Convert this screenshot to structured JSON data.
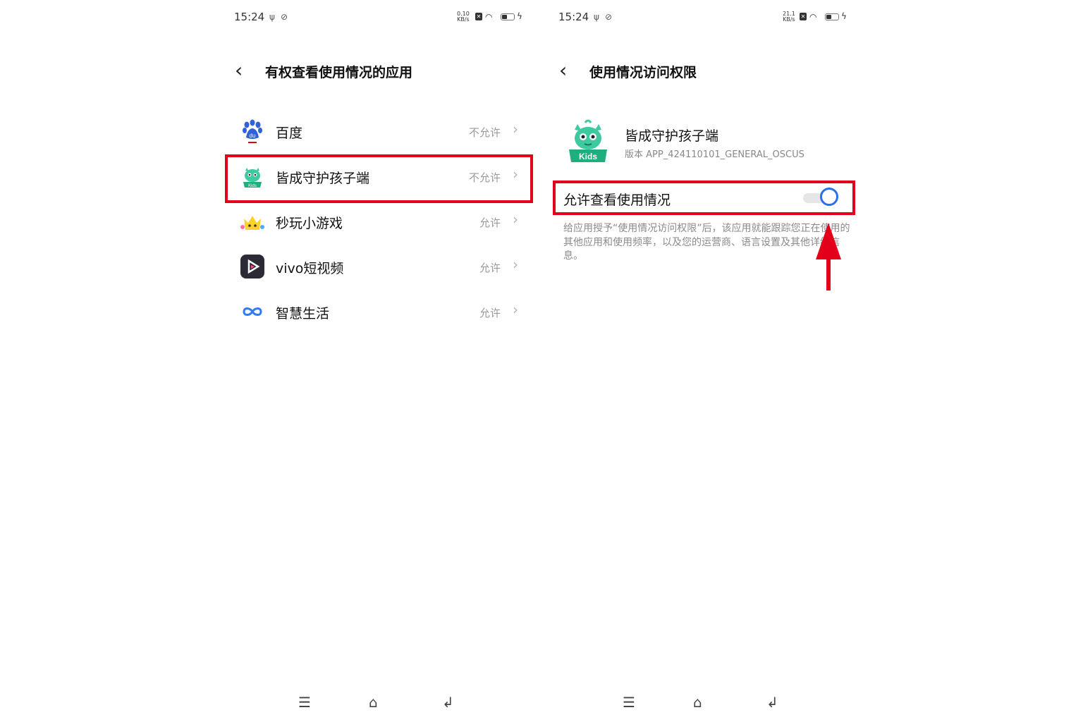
{
  "left": {
    "status_bar": {
      "time": "15:24",
      "net_speed_top": "0.10",
      "net_speed_unit": "KB/s"
    },
    "header": {
      "back_icon": "back-chevron-icon",
      "title": "有权查看使用情况的应用"
    },
    "apps": [
      {
        "name": "百度",
        "status": "不允许",
        "icon": "baidu-paw-icon"
      },
      {
        "name": "皆成守护孩子端",
        "status": "不允许",
        "icon": "kids-monster-icon"
      },
      {
        "name": "秒玩小游戏",
        "status": "允许",
        "icon": "game-crown-icon"
      },
      {
        "name": "vivo短视频",
        "status": "允许",
        "icon": "video-play-icon"
      },
      {
        "name": "智慧生活",
        "status": "允许",
        "icon": "infinity-icon"
      }
    ]
  },
  "right": {
    "status_bar": {
      "time": "15:24",
      "net_speed_top": "21.1",
      "net_speed_unit": "KB/s"
    },
    "header": {
      "back_icon": "back-chevron-icon",
      "title": "使用情况访问权限"
    },
    "app": {
      "name": "皆成守护孩子端",
      "version": "版本 APP_424110101_GENERAL_OSCUS",
      "icon_label": "Kids"
    },
    "permission": {
      "label": "允许查看使用情况",
      "enabled": true
    },
    "description": "给应用授予“使用情况访问权限”后，该应用就能跟踪您正在使用的其他应用和使用频率，以及您的运营商、语言设置及其他详细信息。"
  },
  "kids_icon_text": "Kids",
  "baidu_icon_text": "du",
  "colors": {
    "highlight": "#e3001b",
    "toggle_on": "#2a6ff0",
    "kids_green": "#3ec9a0"
  }
}
